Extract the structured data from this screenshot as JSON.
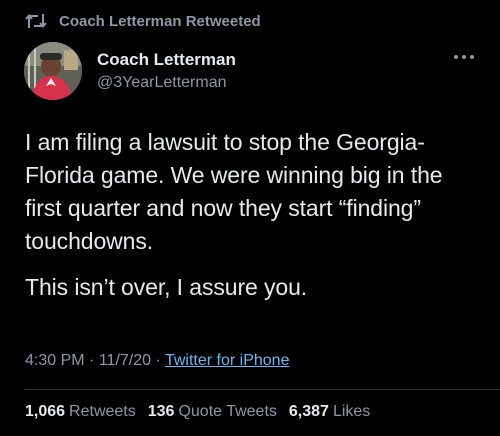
{
  "retweet_context": {
    "label": "Coach Letterman Retweeted",
    "icon": "retweet-icon"
  },
  "author": {
    "display_name": "Coach Letterman",
    "handle": "@3YearLetterman",
    "avatar": "profile-photo"
  },
  "tweet": {
    "paragraphs": [
      "I am filing a lawsuit to stop the Georgia-Florida game. We were winning big in the first quarter and now they start “finding” touchdowns.",
      "This isn’t over, I assure you."
    ],
    "time": "4:30 PM",
    "separator": "·",
    "date": "11/7/20",
    "source": "Twitter for iPhone"
  },
  "stats": {
    "retweets": {
      "count": "1,066",
      "label": "Retweets"
    },
    "quote_tweets": {
      "count": "136",
      "label": "Quote Tweets"
    },
    "likes": {
      "count": "6,387",
      "label": "Likes"
    }
  },
  "colors": {
    "background": "#000000",
    "primary_text": "#e7e9ea",
    "secondary_text": "#8b98a5",
    "link": "#6cb6f0",
    "divider": "#2f3336"
  }
}
